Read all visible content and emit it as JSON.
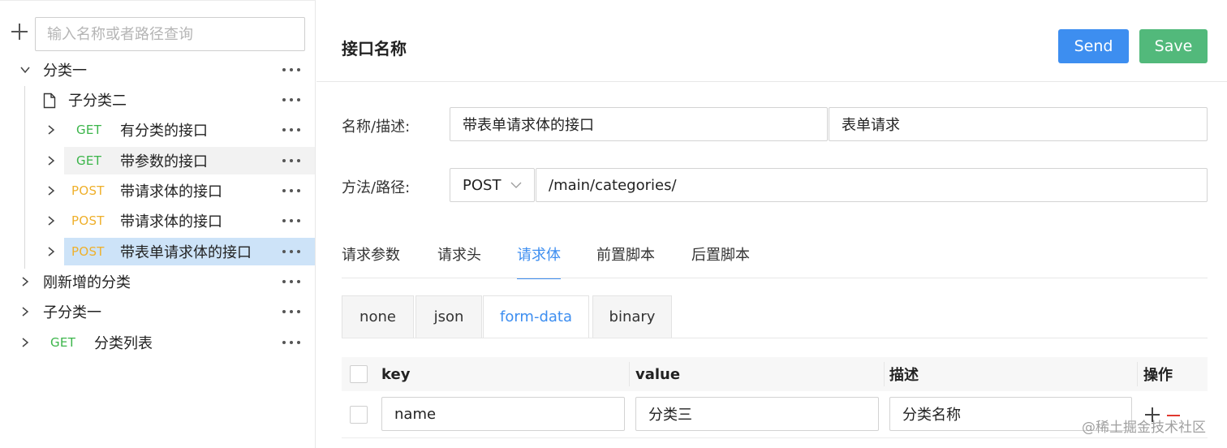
{
  "sidebar": {
    "search_placeholder": "输入名称或者路径查询",
    "tree": [
      {
        "label": "分类一"
      },
      {
        "label": "子分类二"
      },
      {
        "method": "GET",
        "label": "有分类的接口"
      },
      {
        "method": "GET",
        "label": "带参数的接口"
      },
      {
        "method": "POST",
        "label": "带请求体的接口"
      },
      {
        "method": "POST",
        "label": "带请求体的接口"
      },
      {
        "method": "POST",
        "label": "带表单请求体的接口"
      },
      {
        "label": "刚新增的分类"
      },
      {
        "label": "子分类一"
      },
      {
        "method": "GET",
        "label": "分类列表"
      }
    ]
  },
  "header": {
    "title": "接口名称",
    "send_label": "Send",
    "save_label": "Save"
  },
  "form": {
    "name_label": "名称/描述:",
    "name_value": "带表单请求体的接口",
    "desc_value": "表单请求",
    "method_label": "方法/路径:",
    "method_value": "POST",
    "path_value": "/main/categories/"
  },
  "tabs": [
    "请求参数",
    "请求头",
    "请求体",
    "前置脚本",
    "后置脚本"
  ],
  "body_tabs": [
    "none",
    "json",
    "form-data",
    "binary"
  ],
  "table": {
    "headers": {
      "key": "key",
      "value": "value",
      "desc": "描述",
      "op": "操作"
    },
    "rows": [
      {
        "key": "name",
        "value": "分类三",
        "desc": "分类名称"
      }
    ]
  },
  "watermark": "@稀土掘金技术社区",
  "colors": {
    "accent": "#3d8ef0",
    "save": "#52b97b",
    "get": "#3bb54a",
    "post": "#efb02b",
    "selected": "#cde3f8"
  }
}
